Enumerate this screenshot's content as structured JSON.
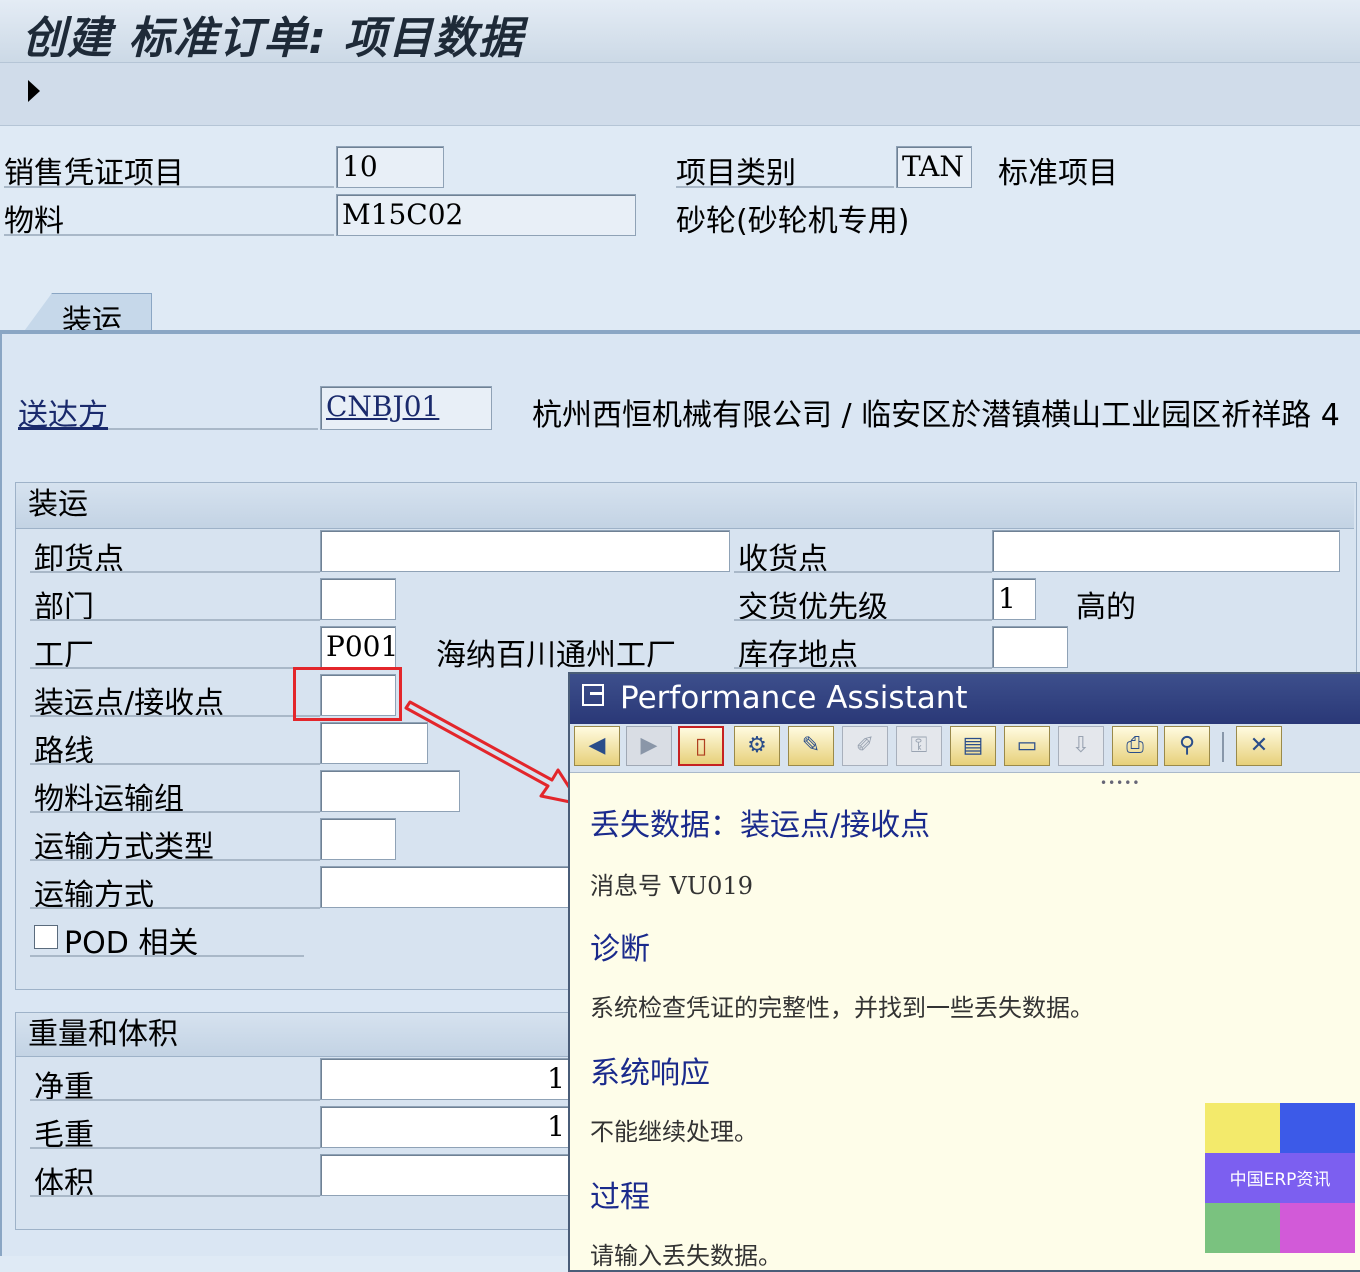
{
  "window": {
    "title": "创建 标准订单: 项目数据"
  },
  "header": {
    "item_label": "销售凭证项目",
    "item_value": "10",
    "item_cat_label": "项目类别",
    "item_cat_value": "TAN",
    "item_cat_desc": "标准项目",
    "material_label": "物料",
    "material_value": "M15C02",
    "material_desc": "砂轮(砂轮机专用)"
  },
  "tabs": [
    {
      "label": "装运"
    }
  ],
  "ship_to": {
    "label": "送达方",
    "value": "CNBJ01",
    "desc": "杭州西恒机械有限公司 / 临安区於潜镇横山工业园区祈祥路 4"
  },
  "shipping": {
    "title": "装运",
    "unloading_point_label": "卸货点",
    "unloading_point_value": "",
    "receiving_point_label": "收货点",
    "receiving_point_value": "",
    "department_label": "部门",
    "department_value": "",
    "delivery_priority_label": "交货优先级",
    "delivery_priority_value": "1",
    "delivery_priority_desc": "高的",
    "plant_label": "工厂",
    "plant_value": "P001",
    "plant_desc": "海纳百川通州工厂",
    "storage_location_label": "库存地点",
    "storage_location_value": "",
    "shipping_point_label": "装运点/接收点",
    "shipping_point_value": "",
    "route_label": "路线",
    "route_value": "",
    "material_freight_group_label": "物料运输组",
    "material_freight_group_value": "",
    "means_of_transport_type_label": "运输方式类型",
    "means_of_transport_type_value": "",
    "means_of_transport_label": "运输方式",
    "means_of_transport_value": "",
    "pod_label": "POD 相关"
  },
  "weight_volume": {
    "title": "重量和体积",
    "net_weight_label": "净重",
    "net_weight_value": "1",
    "gross_weight_label": "毛重",
    "gross_weight_value": "1",
    "volume_label": "体积",
    "volume_value": ""
  },
  "performance_assistant": {
    "title": "Performance Assistant",
    "heading": "丢失数据：装运点/接收点",
    "message_no": "消息号 VU019",
    "diagnosis_title": "诊断",
    "diagnosis_text": "系统检查凭证的完整性，并找到一些丢失数据。",
    "system_response_title": "系统响应",
    "system_response_text": "不能继续处理。",
    "procedure_title": "过程",
    "procedure_text": "请输入丢失数据。"
  },
  "watermark": {
    "text": "中国ERP资讯",
    "colors": [
      "#f3ea6b",
      "#3c5ae8",
      "#7c5ff0",
      "#7ac27f",
      "#d25ad8"
    ]
  },
  "icons": [
    "back-icon",
    "forward-icon",
    "book-icon",
    "structure-icon",
    "edit-icon",
    "pencil-icon",
    "key-icon",
    "notebook-icon",
    "window-icon",
    "export-icon",
    "print-icon",
    "find-icon",
    "close-icon"
  ]
}
